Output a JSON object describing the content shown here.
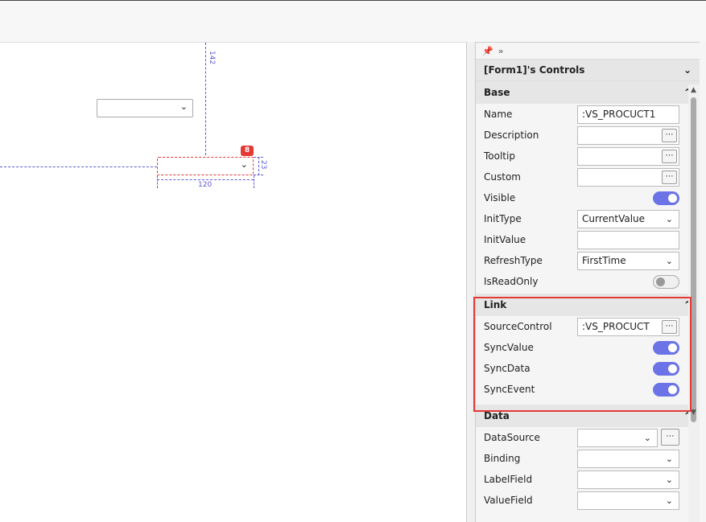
{
  "panel": {
    "title": "[Form1]'s Controls",
    "sections": {
      "base": {
        "title": "Base",
        "name_label": "Name",
        "name_value": ":VS_PROCUCT1",
        "description_label": "Description",
        "tooltip_label": "Tooltip",
        "custom_label": "Custom",
        "visible_label": "Visible",
        "visible": true,
        "inittype_label": "InitType",
        "inittype_value": "CurrentValue",
        "initvalue_label": "InitValue",
        "refreshtype_label": "RefreshType",
        "refreshtype_value": "FirstTime",
        "isreadonly_label": "IsReadOnly",
        "isreadonly": false
      },
      "link": {
        "title": "Link",
        "sourcecontrol_label": "SourceControl",
        "sourcecontrol_value": ":VS_PROCUCT",
        "syncvalue_label": "SyncValue",
        "syncvalue": true,
        "syncdata_label": "SyncData",
        "syncdata": true,
        "syncevent_label": "SyncEvent",
        "syncevent": true
      },
      "data": {
        "title": "Data",
        "datasource_label": "DataSource",
        "binding_label": "Binding",
        "labelfield_label": "LabelField",
        "valuefield_label": "ValueField"
      }
    }
  },
  "canvas": {
    "dim_top": "142",
    "dim_width": "120",
    "dim_height": "23",
    "badge": "8"
  },
  "icons": {
    "pin": "pin-icon",
    "expand": "double-chevron-icon",
    "chevron_down": "chevron-down-icon",
    "chevron_up": "chevron-up-icon",
    "ellipsis": "ellipsis-icon"
  },
  "colors": {
    "accent": "#6b73e6",
    "highlight": "#e53935",
    "guide": "#5b5bd6"
  }
}
